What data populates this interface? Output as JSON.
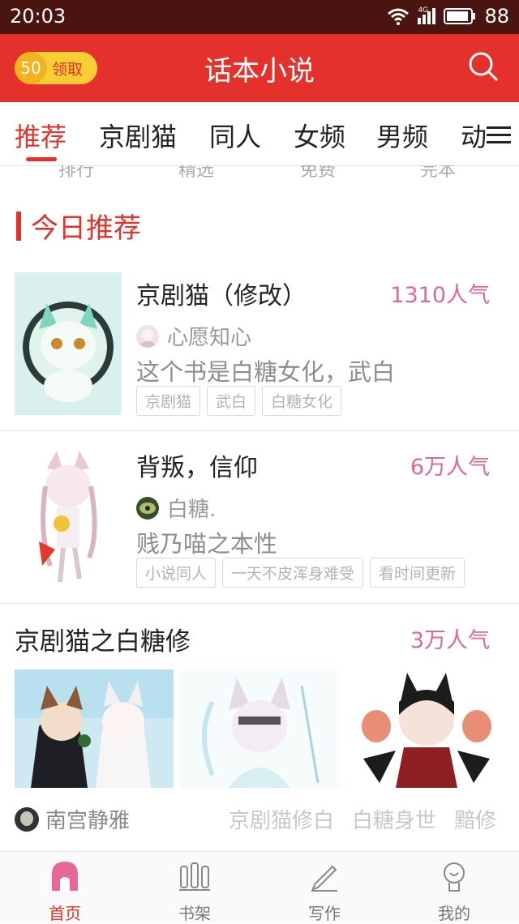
{
  "status": {
    "time": "20:03",
    "network": "4G",
    "battery": "88"
  },
  "appbar": {
    "coin": "50",
    "claim_label": "领取",
    "title": "话本小说"
  },
  "tabs": [
    "推荐",
    "京剧猫",
    "同人",
    "女频",
    "男频",
    "动"
  ],
  "subtabs": [
    "排行",
    "精选",
    "免费",
    "完本"
  ],
  "section": {
    "title": "今日推荐"
  },
  "books": [
    {
      "title": "京剧猫（修改）",
      "popularity": "1310人气",
      "author": "心愿知心",
      "description": "这个书是白糖女化，武白",
      "tags": [
        "京剧猫",
        "武白",
        "白糖女化"
      ]
    },
    {
      "title": "背叛，信仰",
      "popularity": "6万人气",
      "author": "白糖.",
      "description": "贱乃喵之本性",
      "tags": [
        "小说同人",
        "一天不皮浑身难受",
        "看时间更新"
      ]
    }
  ],
  "collection": {
    "title": "京剧猫之白糖修",
    "popularity": "3万人气",
    "author": "南宫静雅",
    "tags": [
      "京剧猫修白",
      "白糖身世",
      "黯修"
    ]
  },
  "bottom_nav": [
    {
      "label": "首页",
      "active": true
    },
    {
      "label": "书架",
      "active": false
    },
    {
      "label": "写作",
      "active": false
    },
    {
      "label": "我的",
      "active": false
    }
  ],
  "colors": {
    "accent": "#e4312b",
    "popularity": "#e0679a",
    "statusbar": "#4a1510"
  }
}
